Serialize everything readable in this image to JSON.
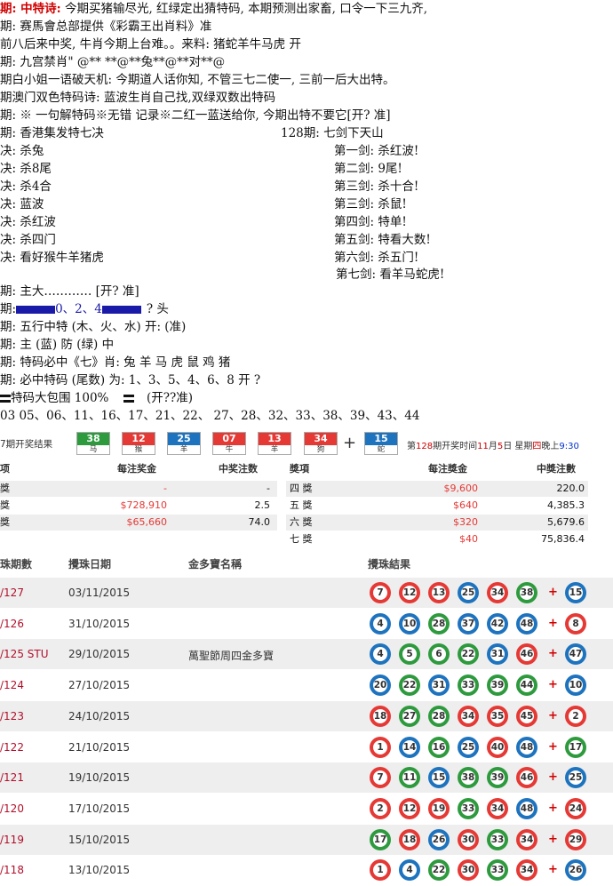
{
  "poem_lines": [
    {
      "text": "期: 中特诗: 今期买猪输尽光, 红绿定出猜特码, 本期预测出家畜, 口令一下三九齐,"
    },
    {
      "text": "期: 赛馬會总部提供《彩霸王出肖料》准"
    },
    {
      "text": "前八后来中奖, 牛肖今期上台难。。来料: 猪蛇羊牛马虎   开"
    },
    {
      "text": "期: 九宫禁肖\"  @** **@**兔**@**对**@"
    },
    {
      "text": "期白小姐一语破天机: 今期道人话你知, 不管三七二使一, 三前一后大出特。"
    },
    {
      "text": "期澳门双色特码诗: 蓝波生肖自己找,双绿双数出特码"
    },
    {
      "text": "期: ※ 一句解特码※无错 记录※二红一蓝送给你, 今期出特不要它[开? 准]"
    }
  ],
  "left_block": {
    "header": "期: 香港集发特七决",
    "lines": [
      "决: 杀兔",
      "决: 杀8尾",
      "决: 杀4合",
      "决: 蓝波",
      "决: 杀红波",
      "决: 杀四门",
      "决: 看好猴牛羊猪虎"
    ]
  },
  "right_block": {
    "header": "128期: 七剑下天山",
    "lines": [
      "第一剑: 杀红波!",
      "第二剑: 9尾!",
      "第三剑: 杀十合!",
      "第三剑: 杀鼠!",
      "第四剑: 特单!",
      "第五剑: 特看大数!",
      "第六剑: 杀五门!",
      "第七剑: 看羊马蛇虎!"
    ]
  },
  "mid_lines": {
    "l1": "期: 主大………… [开? 准]",
    "l2_pre": "期:",
    "l2_nums": "0、2、4",
    "l2_post": "? 头",
    "l3": "期: 五行中特  (木、火、水) 开: (准)",
    "l4": "期: 主 (蓝) 防 (绿) 中",
    "l5": "期: 特码必中《七》肖: 兔 羊 马 虎 鼠 鸡  猪",
    "l6": "期: 必中特码 (尾数) 为: 1、3、5、4、6、8      开 ?",
    "l7_pre": "特码大包围 100%",
    "l7_post": "(开??准)",
    "l8": "03 05、06、11、16、17、21、22、 27、28、32、33、38、39、43、44"
  },
  "draw": {
    "label": "7期开奖结果",
    "cells": [
      {
        "num": "38",
        "zodiac": "马",
        "color": "#2e9a3e"
      },
      {
        "num": "12",
        "zodiac": "猴",
        "color": "#e53935"
      },
      {
        "num": "25",
        "zodiac": "羊",
        "color": "#1e73be"
      },
      {
        "num": "07",
        "zodiac": "牛",
        "color": "#e53935"
      },
      {
        "num": "13",
        "zodiac": "羊",
        "color": "#e53935"
      },
      {
        "num": "34",
        "zodiac": "狗",
        "color": "#e53935"
      }
    ],
    "special": {
      "num": "15",
      "zodiac": "蛇",
      "color": "#1e73be"
    },
    "plus": "+",
    "info_a": "第",
    "info_period": "128",
    "info_b": "期开奖时间",
    "info_month": "11",
    "info_c": "月",
    "info_day": "5",
    "info_d": "日 星期",
    "info_weekday": "四",
    "info_evening": "晚上",
    "info_time": "9:30"
  },
  "prize_left": {
    "headers": [
      "项",
      "每注奖金",
      "中奖注数"
    ],
    "rows": [
      {
        "name": "獎",
        "amount": "-",
        "count": "-"
      },
      {
        "name": "獎",
        "amount": "$728,910",
        "count": "2.5"
      },
      {
        "name": "獎",
        "amount": "$65,660",
        "count": "74.0"
      }
    ]
  },
  "prize_right": {
    "headers": [
      "獎項",
      "每注獎金",
      "中獎注數"
    ],
    "rows": [
      {
        "name": "四 獎",
        "amount": "$9,600",
        "count": "220.0"
      },
      {
        "name": "五 獎",
        "amount": "$640",
        "count": "4,385.3"
      },
      {
        "name": "六 獎",
        "amount": "$320",
        "count": "5,679.6"
      },
      {
        "name": "七 獎",
        "amount": "$40",
        "count": "75,836.4"
      }
    ]
  },
  "history": {
    "headers": [
      "珠期數",
      "攪珠日期",
      "金多寶名稱",
      "攪珠結果"
    ],
    "rows": [
      {
        "id": "/127",
        "date": "03/11/2015",
        "name": "",
        "balls": [
          [
            "7",
            "red"
          ],
          [
            "12",
            "red"
          ],
          [
            "13",
            "red"
          ],
          [
            "25",
            "blue"
          ],
          [
            "34",
            "red"
          ],
          [
            "38",
            "green"
          ]
        ],
        "special": [
          "15",
          "blue"
        ]
      },
      {
        "id": "/126",
        "date": "31/10/2015",
        "name": "",
        "balls": [
          [
            "4",
            "blue"
          ],
          [
            "10",
            "blue"
          ],
          [
            "28",
            "green"
          ],
          [
            "37",
            "blue"
          ],
          [
            "42",
            "blue"
          ],
          [
            "48",
            "blue"
          ]
        ],
        "special": [
          "8",
          "red"
        ]
      },
      {
        "id": "/125 STU",
        "date": "29/10/2015",
        "name": "萬聖節周四金多寶",
        "balls": [
          [
            "4",
            "blue"
          ],
          [
            "5",
            "green"
          ],
          [
            "6",
            "green"
          ],
          [
            "22",
            "green"
          ],
          [
            "31",
            "blue"
          ],
          [
            "46",
            "red"
          ]
        ],
        "special": [
          "47",
          "blue"
        ]
      },
      {
        "id": "/124",
        "date": "27/10/2015",
        "name": "",
        "balls": [
          [
            "20",
            "blue"
          ],
          [
            "22",
            "green"
          ],
          [
            "31",
            "blue"
          ],
          [
            "33",
            "green"
          ],
          [
            "39",
            "green"
          ],
          [
            "44",
            "green"
          ]
        ],
        "special": [
          "10",
          "blue"
        ]
      },
      {
        "id": "/123",
        "date": "24/10/2015",
        "name": "",
        "balls": [
          [
            "18",
            "red"
          ],
          [
            "27",
            "green"
          ],
          [
            "28",
            "green"
          ],
          [
            "34",
            "red"
          ],
          [
            "35",
            "red"
          ],
          [
            "45",
            "red"
          ]
        ],
        "special": [
          "2",
          "red"
        ]
      },
      {
        "id": "/122",
        "date": "21/10/2015",
        "name": "",
        "balls": [
          [
            "1",
            "red"
          ],
          [
            "14",
            "blue"
          ],
          [
            "16",
            "green"
          ],
          [
            "25",
            "blue"
          ],
          [
            "40",
            "red"
          ],
          [
            "48",
            "blue"
          ]
        ],
        "special": [
          "17",
          "green"
        ]
      },
      {
        "id": "/121",
        "date": "19/10/2015",
        "name": "",
        "balls": [
          [
            "7",
            "red"
          ],
          [
            "11",
            "green"
          ],
          [
            "15",
            "blue"
          ],
          [
            "38",
            "green"
          ],
          [
            "39",
            "green"
          ],
          [
            "46",
            "red"
          ]
        ],
        "special": [
          "25",
          "blue"
        ]
      },
      {
        "id": "/120",
        "date": "17/10/2015",
        "name": "",
        "balls": [
          [
            "2",
            "red"
          ],
          [
            "12",
            "red"
          ],
          [
            "19",
            "red"
          ],
          [
            "33",
            "green"
          ],
          [
            "34",
            "red"
          ],
          [
            "48",
            "blue"
          ]
        ],
        "special": [
          "24",
          "red"
        ]
      },
      {
        "id": "/119",
        "date": "15/10/2015",
        "name": "",
        "balls": [
          [
            "17",
            "green"
          ],
          [
            "18",
            "red"
          ],
          [
            "26",
            "blue"
          ],
          [
            "30",
            "red"
          ],
          [
            "33",
            "green"
          ],
          [
            "34",
            "red"
          ]
        ],
        "special": [
          "29",
          "red"
        ]
      },
      {
        "id": "/118",
        "date": "13/10/2015",
        "name": "",
        "balls": [
          [
            "1",
            "red"
          ],
          [
            "4",
            "blue"
          ],
          [
            "22",
            "green"
          ],
          [
            "30",
            "red"
          ],
          [
            "33",
            "green"
          ],
          [
            "34",
            "red"
          ]
        ],
        "special": [
          "26",
          "blue"
        ]
      }
    ]
  }
}
